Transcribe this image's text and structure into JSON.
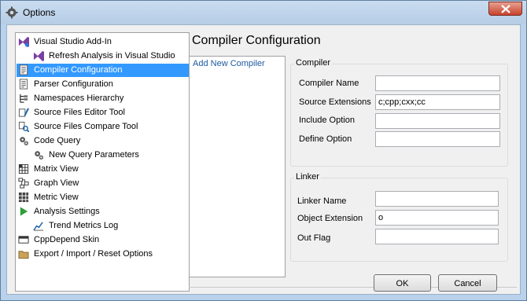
{
  "window": {
    "title": "Options"
  },
  "tree": {
    "items": [
      {
        "label": "Visual Studio Add-In",
        "icon": "vs-addin-icon"
      },
      {
        "label": "Refresh Analysis in Visual Studio",
        "icon": "vs-refresh-icon"
      },
      {
        "label": "Compiler Configuration",
        "icon": "document-icon",
        "selected": true
      },
      {
        "label": "Parser Configuration",
        "icon": "document-icon"
      },
      {
        "label": "Namespaces Hierarchy",
        "icon": "hierarchy-icon"
      },
      {
        "label": "Source Files Editor Tool",
        "icon": "editor-tool-icon"
      },
      {
        "label": "Source Files Compare Tool",
        "icon": "compare-tool-icon"
      },
      {
        "label": "Code Query",
        "icon": "gears-icon"
      },
      {
        "label": "New Query Parameters",
        "icon": "gears-icon"
      },
      {
        "label": "Matrix View",
        "icon": "matrix-icon"
      },
      {
        "label": "Graph View",
        "icon": "graph-icon"
      },
      {
        "label": "Metric View",
        "icon": "metric-icon"
      },
      {
        "label": "Analysis Settings",
        "icon": "play-icon"
      },
      {
        "label": "Trend Metrics Log",
        "icon": "trend-chart-icon"
      },
      {
        "label": "CppDepend Skin",
        "icon": "skin-icon"
      },
      {
        "label": "Export / Import / Reset Options",
        "icon": "folder-icon"
      }
    ]
  },
  "content": {
    "title": "Compiler Configuration",
    "compiler_list": [
      "Add New Compiler"
    ],
    "compiler_group": {
      "label": "Compiler",
      "fields": [
        {
          "label": "Compiler Name",
          "value": ""
        },
        {
          "label": "Source Extensions",
          "value": "c;cpp;cxx;cc"
        },
        {
          "label": "Include Option",
          "value": ""
        },
        {
          "label": "Define Option",
          "value": ""
        }
      ]
    },
    "linker_group": {
      "label": "Linker",
      "fields": [
        {
          "label": "Linker Name",
          "value": ""
        },
        {
          "label": "Object Extension",
          "value": "o"
        },
        {
          "label": "Out Flag",
          "value": ""
        }
      ]
    }
  },
  "buttons": {
    "ok": "OK",
    "cancel": "Cancel"
  },
  "colors": {
    "selection": "#3399ff",
    "close_button": "#c7432c",
    "list_link": "#1e5aa0"
  }
}
